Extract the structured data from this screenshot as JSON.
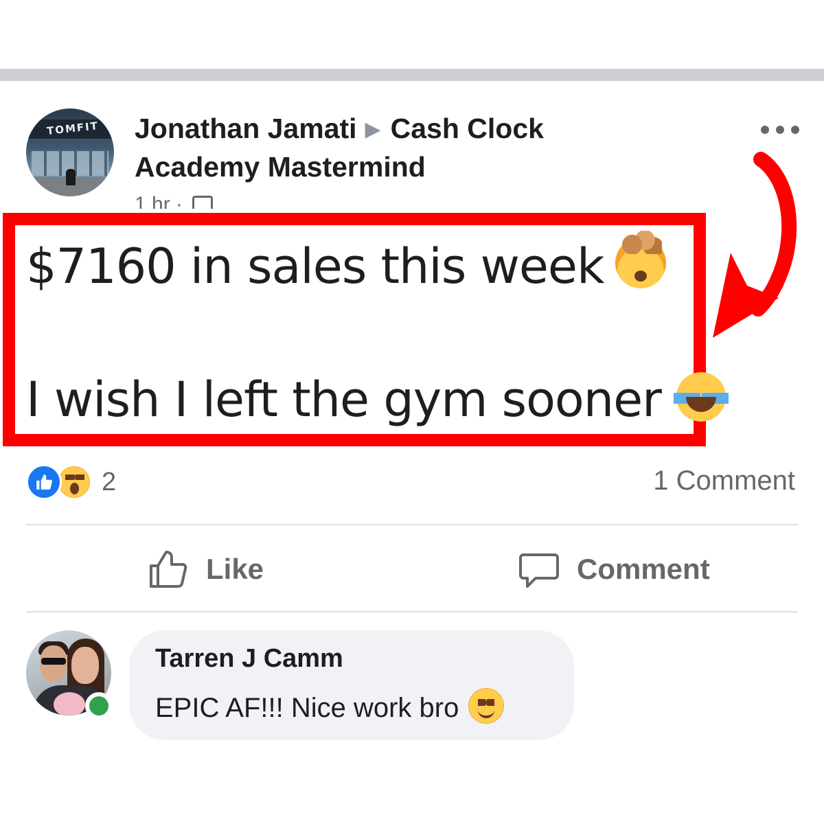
{
  "post": {
    "author": "Jonathan Jamati",
    "group": "Cash Clock Academy Mastermind",
    "timestamp": "1 hr ·",
    "avatar_sign_text": "TOMFIT",
    "line1": "$7160 in sales this week",
    "line2": "I wish I left the gym sooner",
    "line1_emoji": "exploding-head-emoji",
    "line2_emoji": "tears-of-joy-emoji"
  },
  "stats": {
    "reactions": [
      "like",
      "wow"
    ],
    "reaction_count": "2",
    "comment_count": "1 Comment"
  },
  "actions": {
    "like_label": "Like",
    "comment_label": "Comment"
  },
  "comment": {
    "author": "Tarren J Camm",
    "text": "EPIC AF!!! Nice work bro",
    "emoji": "slightly-smiling-emoji",
    "online": true
  },
  "colors": {
    "highlight": "#ff0000",
    "arrow": "#ff0000",
    "facebook_blue": "#1877f2",
    "online_green": "#31a24c",
    "muted_text": "#65676b",
    "bubble_bg": "#f0f2f5"
  }
}
